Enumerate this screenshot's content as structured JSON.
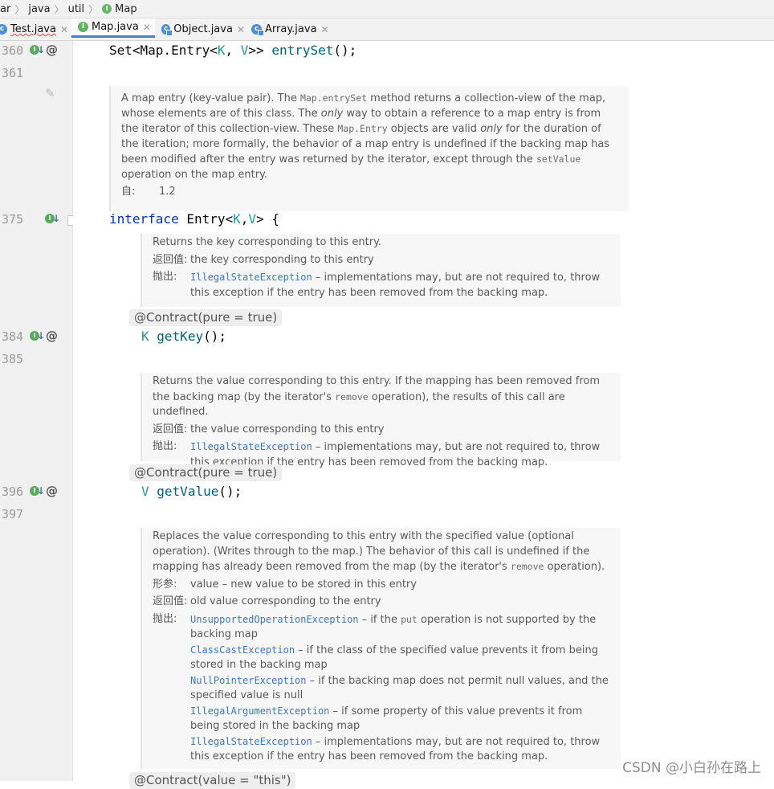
{
  "breadcrumb": [
    "ar",
    "java",
    "util",
    "Map"
  ],
  "tabs": [
    {
      "label": "Test.java",
      "icon": "class-icon"
    },
    {
      "label": "Map.java",
      "icon": "interface-icon",
      "active": true
    },
    {
      "label": "Object.java",
      "icon": "library-class-icon"
    },
    {
      "label": "Array.java",
      "icon": "library-class-icon"
    }
  ],
  "gutter": {
    "line_numbers": [
      "360",
      "361",
      "375",
      "384",
      "385",
      "396",
      "397"
    ]
  },
  "code": {
    "entry_set": [
      "Set<Map.Entry<",
      "K",
      ", ",
      "V",
      ">> ",
      "entrySet",
      "();"
    ],
    "interface_decl": [
      "interface",
      " Entry<",
      "K",
      ",",
      "V",
      "> {"
    ],
    "get_key": [
      "K",
      " ",
      "getKey",
      "();"
    ],
    "get_value": [
      "V",
      " ",
      "getValue",
      "();"
    ],
    "contract_annotation": "@Contract(pure = true)",
    "partial_bottom": "@Contract(value = \"this\")"
  },
  "doc_entry": {
    "t1": "A map entry (key-value pair). The ",
    "m1": "Map.entrySet",
    "t2": " method returns a collection-view of the map, whose elements are of this class. The ",
    "i1": "only",
    "t3": " way to obtain a reference to a map entry is from the iterator of this collection-view. These ",
    "m2": "Map.Entry",
    "t4": " objects are valid ",
    "i2": "only",
    "t5": " for the duration of the iteration; more formally, the behavior of a map entry is undefined if the backing map has been modified after the entry was returned by the iterator, except through the ",
    "m3": "setValue",
    "t6": " operation on the map entry.",
    "since_tag": "自:",
    "since_val": "1.2"
  },
  "doc_getkey": {
    "desc": "Returns the key corresponding to this entry.",
    "return_tag": "返回值:",
    "return_val": "the key corresponding to this entry",
    "throws_tag": "抛出:",
    "ex1": "IllegalStateException",
    "ex1_text": " – implementations may, but are not required to, throw this exception if the entry has been removed from the backing map."
  },
  "doc_getvalue": {
    "d1": "Returns the value corresponding to this entry. If the mapping has been removed from the backing map (by the iterator's ",
    "m1": "remove",
    "d2": " operation), the results of this call are undefined.",
    "return_tag": "返回值:",
    "return_val": "the value corresponding to this entry",
    "throws_tag": "抛出:",
    "ex1": "IllegalStateException",
    "ex1_text": " – implementations may, but are not required to, throw this exception if the entry has been removed from the backing map."
  },
  "doc_setvalue": {
    "d1": "Replaces the value corresponding to this entry with the specified value (optional operation). (Writes through to the map.) The behavior of this call is undefined if the mapping has already been removed from the map (by the iterator's ",
    "m1": "remove",
    "d2": " operation).",
    "param_tag": "形参:",
    "param_val": "value – new value to be stored in this entry",
    "return_tag": "返回值:",
    "return_val": "old value corresponding to the entry",
    "throws_tag": "抛出:",
    "ex1": "UnsupportedOperationException",
    "ex1_a": " – if the ",
    "ex1_m": "put",
    "ex1_b": " operation is not supported by the backing map",
    "ex2": "ClassCastException",
    "ex2_text": " – if the class of the specified value prevents it from being stored in the backing map",
    "ex3": "NullPointerException",
    "ex3_text": " – if the backing map does not permit null values, and the specified value is null",
    "ex4": "IllegalArgumentException",
    "ex4_text": " – if some property of this value prevents it from being stored in the backing map",
    "ex5": "IllegalStateException",
    "ex5_text": " – implementations may, but are not required to, throw this exception if the entry has been removed from the backing map."
  },
  "watermark": "CSDN @小白孙在路上"
}
